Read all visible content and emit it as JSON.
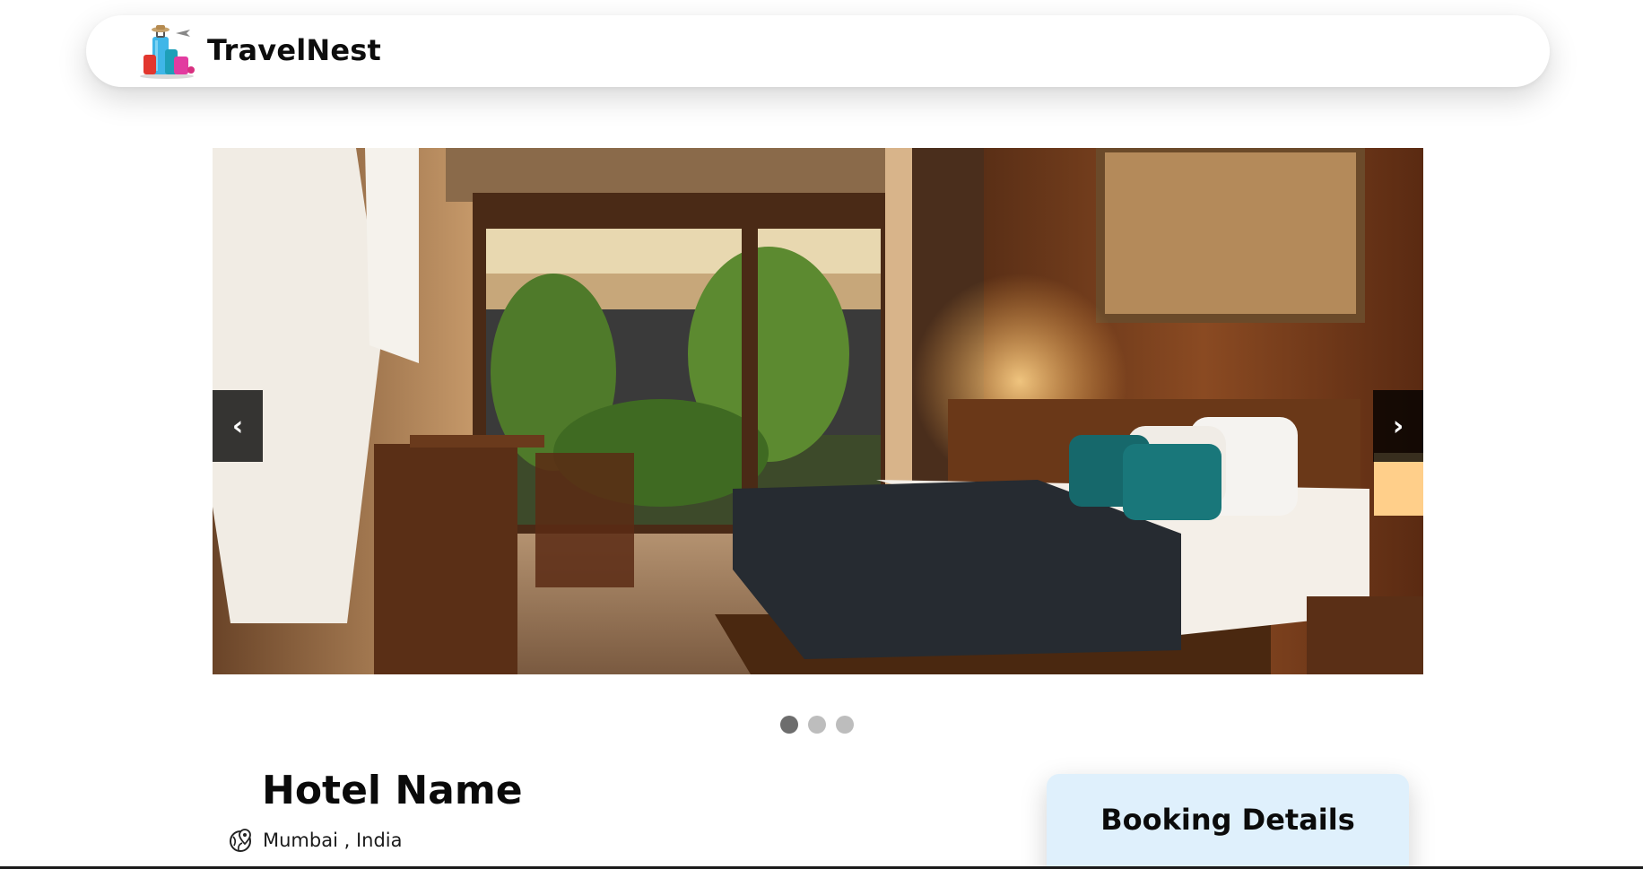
{
  "navbar": {
    "brand": "TravelNest",
    "logo_icon": "luggage-travel-icon"
  },
  "carousel": {
    "prev_label": "‹",
    "next_label": "›",
    "slide_count": 3,
    "active_index": 0,
    "image_alt": "hotel-bedroom-photo"
  },
  "hotel": {
    "name": "Hotel Name",
    "location": "Mumbai , India",
    "location_icon": "globe-pin-icon"
  },
  "booking": {
    "title": "Booking Details"
  },
  "colors": {
    "booking_bg": "#dff0fc",
    "dot_active": "#6d6d6d",
    "dot_inactive": "#bdbdbd",
    "nav_button_bg": "#000000"
  }
}
